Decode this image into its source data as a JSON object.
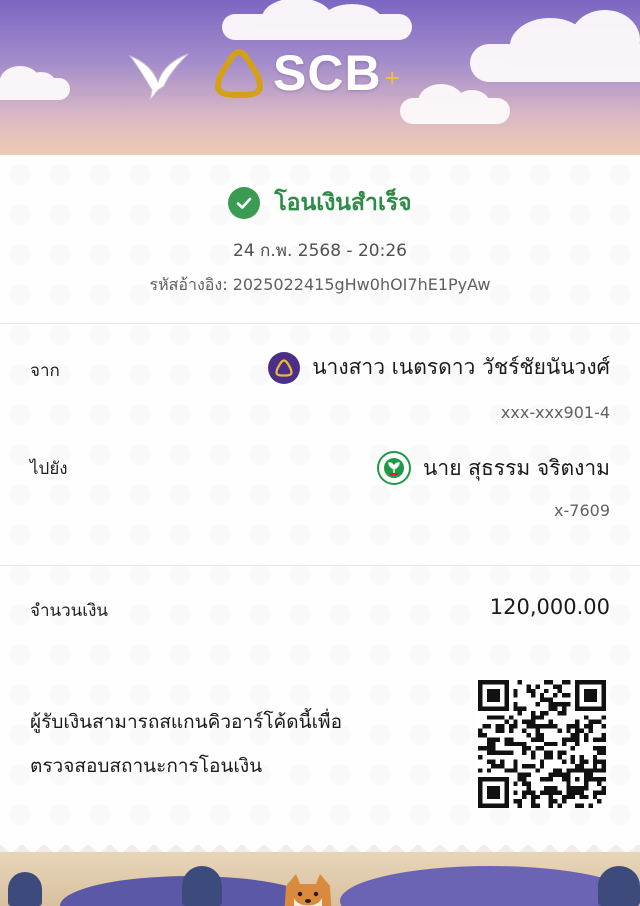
{
  "brand": {
    "name": "SCB",
    "plus": "+"
  },
  "receipt": {
    "status": "โอนเงินสำเร็จ",
    "datetime": "24 ก.พ. 2568 - 20:26",
    "reference": "รหัสอ้างอิง: 2025022415gHw0hOI7hE1PyAw",
    "from": {
      "label": "จาก",
      "name": "นางสาว เนตรดาว วัชร์ชัยนันวงศ์",
      "account": "xxx-xxx901-4"
    },
    "to": {
      "label": "ไปยัง",
      "name": "นาย สุธรรม จริตงาม",
      "account": "x-7609"
    },
    "amount_label": "จำนวนเงิน",
    "amount": "120,000.00",
    "qr_note_line1": "ผู้รับเงินสามารถสแกนคิวอาร์โค้ดนี้เพื่อ",
    "qr_note_line2": "ตรวจสอบสถานะการโอนเงิน"
  },
  "colors": {
    "accent_green": "#2e8c48",
    "scb_purple": "#4b2f86",
    "kbank_green": "#1d9a46",
    "gold": "#d4a017"
  },
  "icons": {
    "success": "check-circle-icon",
    "from_bank": "scb-bank-icon",
    "to_bank": "kbank-bank-icon",
    "qr": "qr-code"
  }
}
